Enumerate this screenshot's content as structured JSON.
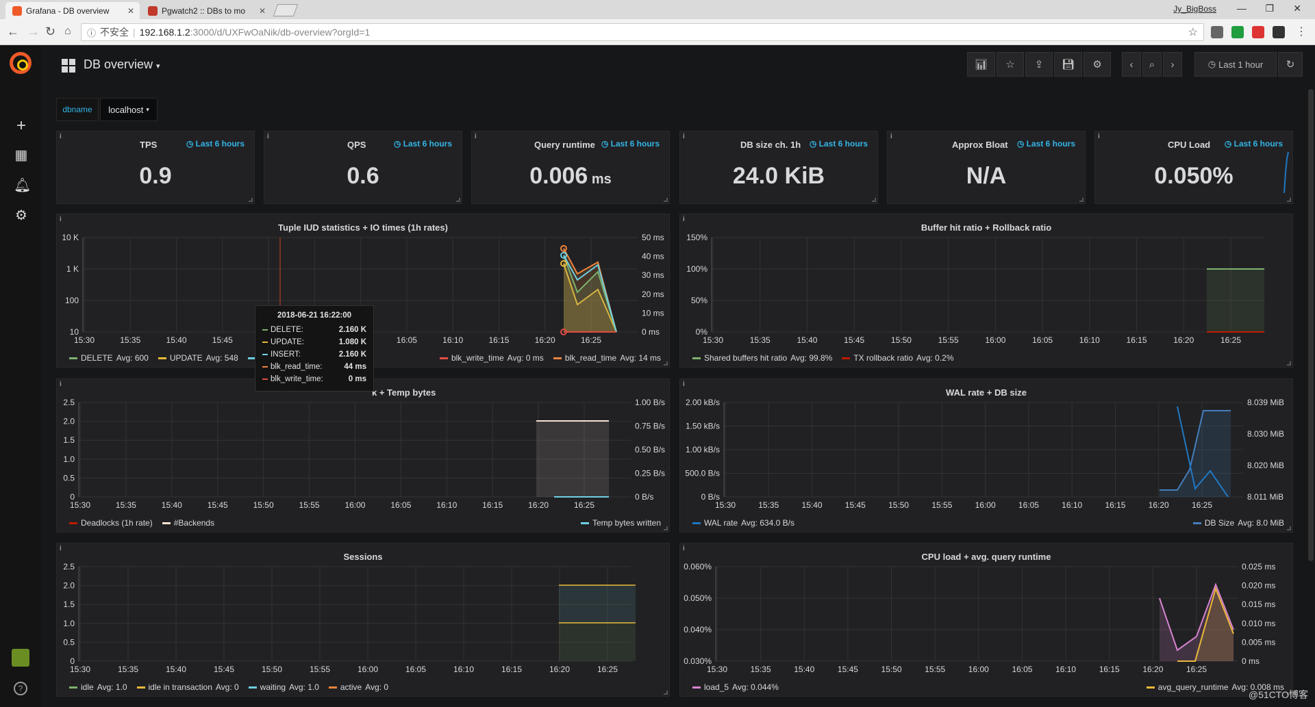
{
  "browser": {
    "tabs": [
      {
        "title": "Grafana - DB overview",
        "active": true
      },
      {
        "title": "Pgwatch2 :: DBs to mo",
        "active": false
      }
    ],
    "user": "Jy_BigBoss",
    "security_label": "不安全",
    "url_host": "192.168.1.2",
    "url_rest": ":3000/d/UXFwOaNik/db-overview?orgId=1"
  },
  "dashboard": {
    "title": "DB overview",
    "time_range": "Last 1 hour"
  },
  "variables": {
    "label": "dbname",
    "value": "localhost"
  },
  "stats": [
    {
      "title": "TPS",
      "time": "Last 6 hours",
      "value": "0.9",
      "unit": ""
    },
    {
      "title": "QPS",
      "time": "Last 6 hours",
      "value": "0.6",
      "unit": ""
    },
    {
      "title": "Query runtime",
      "time": "Last 6 hours",
      "value": "0.006",
      "unit": "ms"
    },
    {
      "title": "DB size ch. 1h",
      "time": "Last 6 hours",
      "value": "24.0 KiB",
      "unit": ""
    },
    {
      "title": "Approx Bloat",
      "time": "Last 6 hours",
      "value": "N/A",
      "unit": ""
    },
    {
      "title": "CPU Load",
      "time": "Last 6 hours",
      "value": "0.050%",
      "unit": ""
    }
  ],
  "panels": {
    "tuple": {
      "title": "Tuple IUD statistics + IO times (1h rates)",
      "y_left": [
        "10 K",
        "1 K",
        "100",
        "10"
      ],
      "y_right": [
        "50 ms",
        "40 ms",
        "30 ms",
        "20 ms",
        "10 ms",
        "0 ms"
      ],
      "x_ticks": [
        "15:30",
        "15:35",
        "15:40",
        "15:45",
        "15:50",
        "15:55",
        "16:00",
        "16:05",
        "16:10",
        "16:15",
        "16:20",
        "16:25"
      ],
      "legend_left": [
        {
          "name": "DELETE",
          "stat": "Avg: 600",
          "color": "#7eb26d"
        },
        {
          "name": "UPDATE",
          "stat": "Avg: 548",
          "color": "#eab839"
        },
        {
          "name": "IN",
          "stat": "",
          "color": "#6ed0e0"
        }
      ],
      "legend_right": [
        {
          "name": "blk_write_time",
          "stat": "Avg: 0 ms",
          "color": "#e24d42"
        },
        {
          "name": "blk_read_time",
          "stat": "Avg: 14 ms",
          "color": "#ef843c"
        }
      ]
    },
    "tooltip": {
      "title": "2018-06-21 16:22:00",
      "rows": [
        {
          "name": "DELETE:",
          "value": "2.160 K",
          "color": "#7eb26d"
        },
        {
          "name": "UPDATE:",
          "value": "1.080 K",
          "color": "#eab839"
        },
        {
          "name": "INSERT:",
          "value": "2.160 K",
          "color": "#6ed0e0"
        },
        {
          "name": "blk_read_time:",
          "value": "44 ms",
          "color": "#ef843c"
        },
        {
          "name": "blk_write_time:",
          "value": "0 ms",
          "color": "#e24d42"
        }
      ]
    },
    "buffer": {
      "title": "Buffer hit ratio + Rollback ratio",
      "y_left": [
        "150%",
        "100%",
        "50%",
        "0%"
      ],
      "x_ticks": [
        "15:30",
        "15:35",
        "15:40",
        "15:45",
        "15:50",
        "15:55",
        "16:00",
        "16:05",
        "16:10",
        "16:15",
        "16:20",
        "16:25"
      ],
      "legend": [
        {
          "name": "Shared buffers hit ratio",
          "stat": "Avg: 99.8%",
          "color": "#7eb26d"
        },
        {
          "name": "TX rollback ratio",
          "stat": "Avg: 0.2%",
          "color": "#bf1b00"
        }
      ]
    },
    "deadlocks": {
      "title": "k + Temp bytes",
      "y_left": [
        "2.5",
        "2.0",
        "1.5",
        "1.0",
        "0.5",
        "0"
      ],
      "y_right": [
        "1.00 B/s",
        "0.75 B/s",
        "0.50 B/s",
        "0.25 B/s",
        "0 B/s"
      ],
      "x_ticks": [
        "15:30",
        "15:35",
        "15:40",
        "15:45",
        "15:50",
        "15:55",
        "16:00",
        "16:05",
        "16:10",
        "16:15",
        "16:20",
        "16:25"
      ],
      "legend_left": [
        {
          "name": "Deadlocks (1h rate)",
          "color": "#bf1b00"
        },
        {
          "name": "#Backends",
          "color": "#f9e2d2"
        }
      ],
      "legend_right": [
        {
          "name": "Temp bytes written",
          "color": "#6ed0e0"
        }
      ]
    },
    "wal": {
      "title": "WAL rate + DB size",
      "y_left": [
        "2.00 kB/s",
        "1.50 kB/s",
        "1.00 kB/s",
        "500.0 B/s",
        "0 B/s"
      ],
      "y_right": [
        "8.039 MiB",
        "8.030 MiB",
        "8.020 MiB",
        "8.011 MiB"
      ],
      "x_ticks": [
        "15:30",
        "15:35",
        "15:40",
        "15:45",
        "15:50",
        "15:55",
        "16:00",
        "16:05",
        "16:10",
        "16:15",
        "16:20",
        "16:25"
      ],
      "legend_left": [
        {
          "name": "WAL rate",
          "stat": "Avg: 634.0 B/s",
          "color": "#1f78c1"
        }
      ],
      "legend_right": [
        {
          "name": "DB Size",
          "stat": "Avg: 8.0 MiB",
          "color": "#447ebc"
        }
      ]
    },
    "sessions": {
      "title": "Sessions",
      "y_left": [
        "2.5",
        "2.0",
        "1.5",
        "1.0",
        "0.5",
        "0"
      ],
      "x_ticks": [
        "15:30",
        "15:35",
        "15:40",
        "15:45",
        "15:50",
        "15:55",
        "16:00",
        "16:05",
        "16:10",
        "16:15",
        "16:20",
        "16:25"
      ],
      "legend": [
        {
          "name": "idle",
          "stat": "Avg: 1.0",
          "color": "#7eb26d"
        },
        {
          "name": "idle in transaction",
          "stat": "Avg: 0",
          "color": "#eab839"
        },
        {
          "name": "waiting",
          "stat": "Avg: 1.0",
          "color": "#6ed0e0"
        },
        {
          "name": "active",
          "stat": "Avg: 0",
          "color": "#ef843c"
        }
      ]
    },
    "cpu": {
      "title": "CPU load + avg. query runtime",
      "y_left": [
        "0.060%",
        "0.050%",
        "0.040%",
        "0.030%"
      ],
      "y_right": [
        "0.025 ms",
        "0.020 ms",
        "0.015 ms",
        "0.010 ms",
        "0.005 ms",
        "0 ms"
      ],
      "x_ticks": [
        "15:30",
        "15:35",
        "15:40",
        "15:45",
        "15:50",
        "15:55",
        "16:00",
        "16:05",
        "16:10",
        "16:15",
        "16:20",
        "16:25"
      ],
      "legend_left": [
        {
          "name": "load_5",
          "stat": "Avg: 0.044%",
          "color": "#d683ce"
        }
      ],
      "legend_right": [
        {
          "name": "avg_query_runtime",
          "stat": "Avg: 0.008 ms",
          "color": "#eab839"
        }
      ]
    }
  },
  "chart_data": [
    {
      "type": "line",
      "title": "Tuple IUD statistics + IO times (1h rates)",
      "x": [
        "16:22",
        "16:23",
        "16:24",
        "16:25",
        "16:26"
      ],
      "series": [
        {
          "name": "DELETE",
          "values": [
            2160,
            300,
            800,
            200,
            10
          ]
        },
        {
          "name": "UPDATE",
          "values": [
            1080,
            200,
            300,
            150,
            10
          ]
        },
        {
          "name": "INSERT",
          "values": [
            2160,
            600,
            1500,
            300,
            10
          ]
        },
        {
          "name": "blk_read_time",
          "values": [
            44,
            20,
            10,
            5,
            0
          ]
        },
        {
          "name": "blk_write_time",
          "values": [
            0,
            0,
            0,
            0,
            0
          ]
        }
      ]
    },
    {
      "type": "line",
      "title": "Buffer hit ratio + Rollback ratio",
      "x": [
        "16:21",
        "16:27"
      ],
      "series": [
        {
          "name": "Shared buffers hit ratio",
          "values": [
            100,
            100
          ]
        },
        {
          "name": "TX rollback ratio",
          "values": [
            0,
            0
          ]
        }
      ]
    },
    {
      "type": "line",
      "title": "WAL rate + DB size",
      "x": [
        "16:21",
        "16:22",
        "16:23",
        "16:24",
        "16:25",
        "16:26"
      ],
      "series": [
        {
          "name": "WAL rate",
          "values": [
            200,
            2000,
            200,
            500,
            0,
            0
          ]
        },
        {
          "name": "DB Size",
          "values": [
            8.011,
            8.011,
            8.015,
            8.039,
            8.039,
            8.039
          ]
        }
      ]
    },
    {
      "type": "line",
      "title": "CPU load + avg. query runtime",
      "x": [
        "16:21",
        "16:22",
        "16:23",
        "16:24",
        "16:25"
      ],
      "series": [
        {
          "name": "load_5",
          "values": [
            0.05,
            0.035,
            0.04,
            0.054,
            0.042
          ]
        },
        {
          "name": "avg_query_runtime",
          "values": [
            0,
            0,
            0.009,
            0.02,
            0.01
          ]
        }
      ]
    }
  ]
}
